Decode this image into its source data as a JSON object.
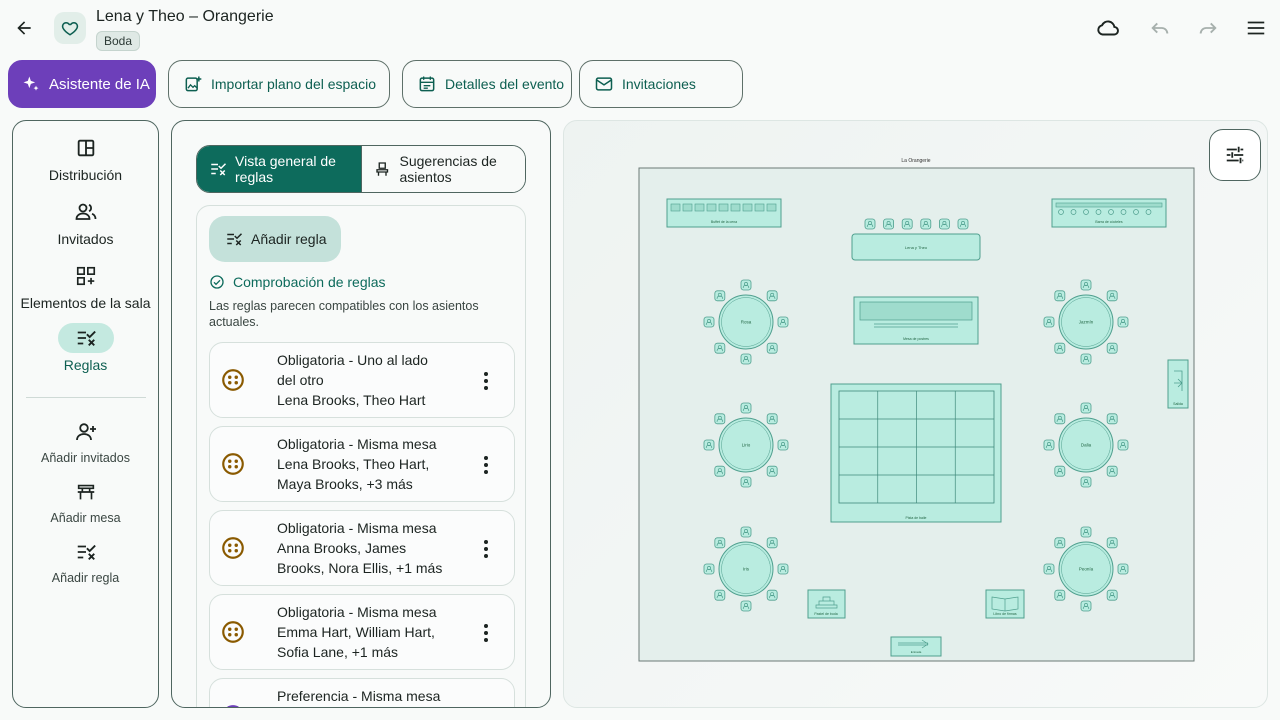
{
  "header": {
    "title": "Lena y Theo – Orangerie",
    "badge": "Boda"
  },
  "actions": {
    "ai": "Asistente de IA",
    "import": "Importar plano del espacio",
    "details": "Detalles del evento",
    "invites": "Invitaciones"
  },
  "rail": {
    "items": [
      {
        "label": "Distribución",
        "icon": "layout-icon"
      },
      {
        "label": "Invitados",
        "icon": "people-icon"
      },
      {
        "label": "Elementos de la sala",
        "icon": "grid-add-icon"
      },
      {
        "label": "Reglas",
        "icon": "rules-icon"
      }
    ],
    "quick": [
      {
        "label": "Añadir invitados",
        "icon": "person-add-icon"
      },
      {
        "label": "Añadir mesa",
        "icon": "table-icon"
      },
      {
        "label": "Añadir regla",
        "icon": "rule-add-icon"
      }
    ]
  },
  "rules": {
    "tabs": {
      "overview": "Vista general de reglas",
      "suggestions": "Sugerencias de asientos"
    },
    "add_rule": "Añadir regla",
    "check_title": "Comprobación de reglas",
    "check_desc": "Las reglas parecen compatibles con los asientos actuales.",
    "items": [
      {
        "title": "Obligatoria - Uno al lado del otro",
        "people": "Lena Brooks, Theo Hart"
      },
      {
        "title": "Obligatoria - Misma mesa",
        "people": "Lena Brooks, Theo Hart, Maya Brooks, +3 más"
      },
      {
        "title": "Obligatoria - Misma mesa",
        "people": "Anna Brooks, James Brooks, Nora Ellis, +1 más"
      },
      {
        "title": "Obligatoria - Misma mesa",
        "people": "Emma Hart, William Hart, Sofia Lane, +1 más"
      },
      {
        "title": "Preferencia - Misma mesa",
        "people": ""
      }
    ]
  },
  "plan": {
    "venue_name": "La Orangerie",
    "elements": {
      "buffet": "Buffet de la cena",
      "cocktail": "Barra de cócteles",
      "head_table": "Lena y Theo",
      "dessert": "Mesa de postres",
      "dance_floor": "Pista de baile",
      "exit": "Salida",
      "cake": "Pastel de boda",
      "guestbook": "Libro de firmas",
      "entrance": "Entrada"
    },
    "tables": [
      {
        "name": "Rosa"
      },
      {
        "name": "Jazmín"
      },
      {
        "name": "Lirio"
      },
      {
        "name": "Dalia"
      },
      {
        "name": "Iris"
      },
      {
        "name": "Peonía"
      }
    ]
  },
  "colors": {
    "primary": "#0d6b5c",
    "ai": "#6d3fba",
    "plan_fill": "#b9ece0",
    "plan_stroke": "#4f9f8e",
    "rule_icon": "#8a5a00"
  }
}
